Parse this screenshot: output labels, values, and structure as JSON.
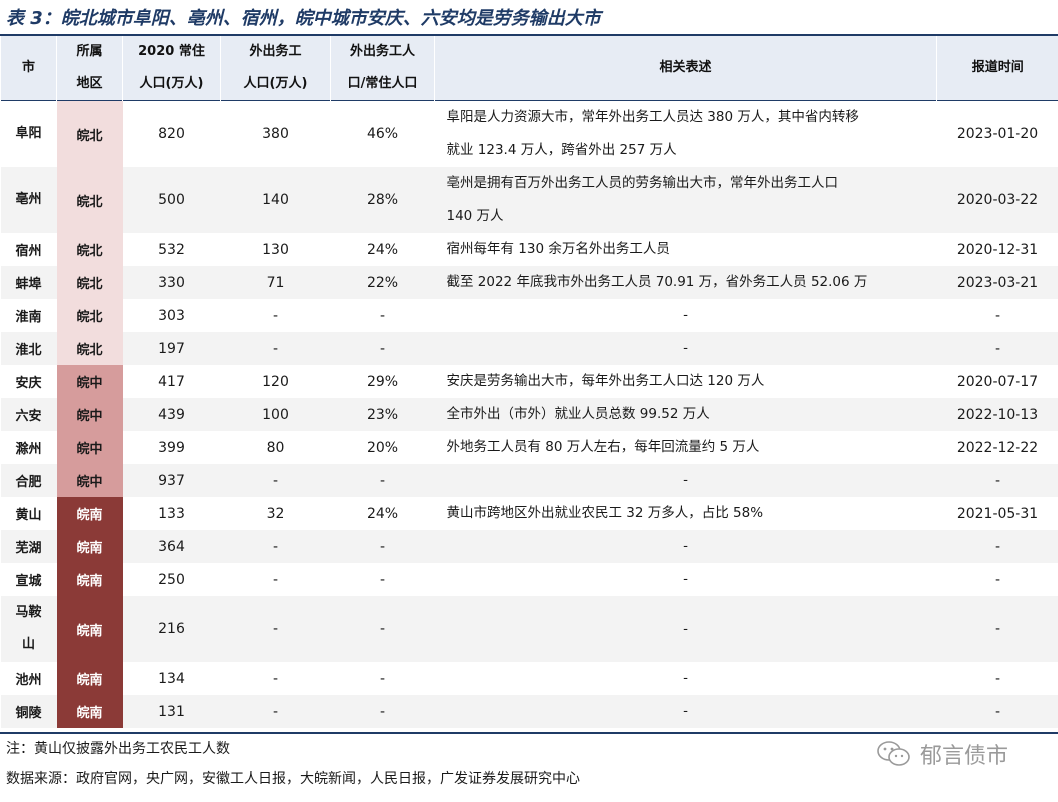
{
  "title": "表 3：皖北城市阜阳、亳州、宿州，皖中城市安庆、六安均是劳务输出大市",
  "headers": [
    "市",
    "所属地区",
    "2020 常住人口(万人)",
    "外出务工人口(万人)",
    "外出务工人口/常住人口",
    "相关表述",
    "报道时间"
  ],
  "header_lines": {
    "h0": "市",
    "h1a": "所属",
    "h1b": "地区",
    "h2a": "2020 常住",
    "h2b": "人口(万人)",
    "h3a": "外出务工",
    "h3b": "人口(万人)",
    "h4a": "外出务工人",
    "h4b": "口/常住人口",
    "h5": "相关表述",
    "h6": "报道时间"
  },
  "rows": [
    {
      "city": "阜阳",
      "region": "皖北",
      "pop": "820",
      "migrant": "380",
      "ratio": "46%",
      "desc1": "阜阳是人力资源大市，常年外出务工人员达 380 万人，其中省内转移",
      "desc2": "就业 123.4 万人，跨省外出 257 万人",
      "date": "2023-01-20"
    },
    {
      "city": "亳州",
      "region": "皖北",
      "pop": "500",
      "migrant": "140",
      "ratio": "28%",
      "desc1": "亳州是拥有百万外出务工人员的劳务输出大市，常年外出务工人口",
      "desc2": "140 万人",
      "date": "2020-03-22"
    },
    {
      "city": "宿州",
      "region": "皖北",
      "pop": "532",
      "migrant": "130",
      "ratio": "24%",
      "desc": "宿州每年有 130 余万名外出务工人员",
      "date": "2020-12-31"
    },
    {
      "city": "蚌埠",
      "region": "皖北",
      "pop": "330",
      "migrant": "71",
      "ratio": "22%",
      "desc": "截至 2022 年底我市外出务工人员 70.91 万，省外务工人员 52.06 万",
      "date": "2023-03-21"
    },
    {
      "city": "淮南",
      "region": "皖北",
      "pop": "303",
      "migrant": "-",
      "ratio": "-",
      "desc": "-",
      "date": "-"
    },
    {
      "city": "淮北",
      "region": "皖北",
      "pop": "197",
      "migrant": "-",
      "ratio": "-",
      "desc": "-",
      "date": "-"
    },
    {
      "city": "安庆",
      "region": "皖中",
      "pop": "417",
      "migrant": "120",
      "ratio": "29%",
      "desc": "安庆是劳务输出大市，每年外出务工人口达 120 万人",
      "date": "2020-07-17"
    },
    {
      "city": "六安",
      "region": "皖中",
      "pop": "439",
      "migrant": "100",
      "ratio": "23%",
      "desc": "全市外出（市外）就业人员总数 99.52 万人",
      "date": "2022-10-13"
    },
    {
      "city": "滁州",
      "region": "皖中",
      "pop": "399",
      "migrant": "80",
      "ratio": "20%",
      "desc": "外地务工人员有 80 万人左右，每年回流量约 5 万人",
      "date": "2022-12-22"
    },
    {
      "city": "合肥",
      "region": "皖中",
      "pop": "937",
      "migrant": "-",
      "ratio": "-",
      "desc": "-",
      "date": "-"
    },
    {
      "city": "黄山",
      "region": "皖南",
      "pop": "133",
      "migrant": "32",
      "ratio": "24%",
      "desc": "黄山市跨地区外出就业农民工 32 万多人，占比 58%",
      "date": "2021-05-31"
    },
    {
      "city": "芜湖",
      "region": "皖南",
      "pop": "364",
      "migrant": "-",
      "ratio": "-",
      "desc": "-",
      "date": "-"
    },
    {
      "city": "宣城",
      "region": "皖南",
      "pop": "250",
      "migrant": "-",
      "ratio": "-",
      "desc": "-",
      "date": "-"
    },
    {
      "city1": "马鞍",
      "city2": "山",
      "city": "马鞍山",
      "region": "皖南",
      "pop": "216",
      "migrant": "-",
      "ratio": "-",
      "desc": "-",
      "date": "-"
    },
    {
      "city": "池州",
      "region": "皖南",
      "pop": "134",
      "migrant": "-",
      "ratio": "-",
      "desc": "-",
      "date": "-"
    },
    {
      "city": "铜陵",
      "region": "皖南",
      "pop": "131",
      "migrant": "-",
      "ratio": "-",
      "desc": "-",
      "date": "-"
    }
  ],
  "region_colors": {
    "皖北": "#f2dddd",
    "皖中": "#d69c9c",
    "皖南": "#8b3a37"
  },
  "note": "注：黄山仅披露外出务工农民工人数",
  "source": "数据来源：政府官网，央广网，安徽工人日报，大皖新闻，人民日报，广发证券发展研究中心",
  "watermark": "郁言债市",
  "watermark_icon": "wechat-icon"
}
